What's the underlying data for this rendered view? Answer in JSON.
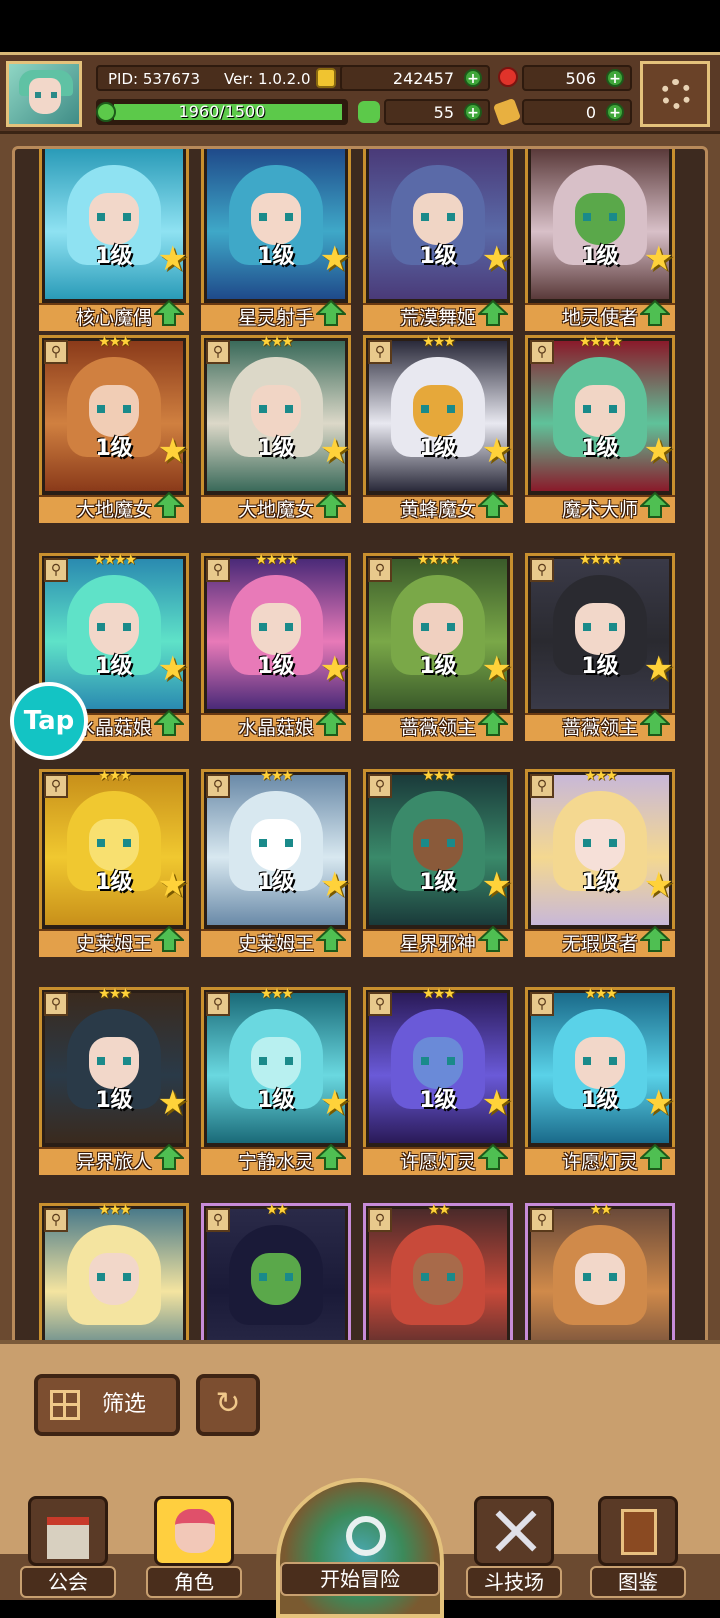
{
  "header": {
    "pid_label": "PID: 537673",
    "version_label": "Ver: 1.0.2.0",
    "gold": "242457",
    "gems": "506",
    "clover": "55",
    "tickets": "0",
    "xp_text": "1960/1500",
    "xp_fraction": 1.0
  },
  "colors": {
    "gold_coin": "#f0c430",
    "gem": "#e0332a",
    "clover": "#5cc94a",
    "accent": "#c9902e"
  },
  "characters": [
    {
      "name": "核心魔偶",
      "level": "1级",
      "palette": [
        "#2a9bb8",
        "#8fe2f2",
        "#f2d7c9"
      ]
    },
    {
      "name": "星灵射手",
      "level": "1级",
      "palette": [
        "#1f4a8a",
        "#3fa8c8",
        "#f3d7c8"
      ]
    },
    {
      "name": "荒漠舞姬",
      "level": "1级",
      "palette": [
        "#4a3a78",
        "#5a6aa8",
        "#f0d5c5"
      ]
    },
    {
      "name": "地灵使者",
      "level": "1级",
      "palette": [
        "#5a3a3a",
        "#d8c0c8",
        "#5aa84a"
      ]
    },
    {
      "name": "大地魔女",
      "level": "1级",
      "rarity": "★★★",
      "palette": [
        "#8a3a1a",
        "#d08040",
        "#f1cdb5"
      ]
    },
    {
      "name": "大地魔女",
      "level": "1级",
      "rarity": "★★★",
      "palette": [
        "#3a6a5a",
        "#dcd8c8",
        "#f1d5c5"
      ]
    },
    {
      "name": "黄蜂魔女",
      "level": "1级",
      "rarity": "★★★",
      "palette": [
        "#2a2a3a",
        "#e8e8f0",
        "#e6a83a"
      ]
    },
    {
      "name": "魔术大师",
      "level": "1级",
      "rarity": "★★★★",
      "palette": [
        "#8a1a2a",
        "#5fc29a",
        "#f1d5c5"
      ]
    },
    {
      "name": "水晶菇娘",
      "level": "1级",
      "rarity": "★★★★",
      "palette": [
        "#2a8ab0",
        "#5fe2c8",
        "#f2d7c9"
      ]
    },
    {
      "name": "水晶菇娘",
      "level": "1级",
      "rarity": "★★★★",
      "palette": [
        "#4a2a78",
        "#e87ab8",
        "#f2d7c9"
      ]
    },
    {
      "name": "蔷薇领主",
      "level": "1级",
      "rarity": "★★★★",
      "palette": [
        "#3a5a2a",
        "#7aa848",
        "#f0d0c0"
      ]
    },
    {
      "name": "蔷薇领主",
      "level": "1级",
      "rarity": "★★★★",
      "palette": [
        "#3a3a48",
        "#2a2a30",
        "#f2d7c9"
      ]
    },
    {
      "name": "史莱姆王",
      "level": "1级",
      "rarity": "★★★",
      "palette": [
        "#c8901a",
        "#f0c830",
        "#f8e070"
      ]
    },
    {
      "name": "史莱姆王",
      "level": "1级",
      "rarity": "★★★",
      "palette": [
        "#6a8aa8",
        "#d8e8f0",
        "#ffffff"
      ]
    },
    {
      "name": "星界邪神",
      "level": "1级",
      "rarity": "★★★",
      "palette": [
        "#1a3a3a",
        "#3a8a6a",
        "#8a5a3a"
      ]
    },
    {
      "name": "无瑕贤者",
      "level": "1级",
      "rarity": "★★★",
      "palette": [
        "#c8b8d8",
        "#f4d890",
        "#f6e0d8"
      ]
    },
    {
      "name": "异界旅人",
      "level": "1级",
      "rarity": "★★★",
      "palette": [
        "#3a2a1e",
        "#2a3a48",
        "#f2d7c9"
      ]
    },
    {
      "name": "宁静水灵",
      "level": "1级",
      "rarity": "★★★",
      "palette": [
        "#1a6a78",
        "#6ad8e0",
        "#b8f0f0"
      ]
    },
    {
      "name": "许愿灯灵",
      "level": "1级",
      "rarity": "★★★",
      "palette": [
        "#2a1a58",
        "#6a5ad8",
        "#6a8ad8"
      ]
    },
    {
      "name": "许愿灯灵",
      "level": "1级",
      "rarity": "★★★",
      "palette": [
        "#1a6a8a",
        "#5ad2e8",
        "#f2d7c9"
      ]
    },
    {
      "name": "",
      "level": "",
      "rarity": "★★★",
      "palette": [
        "#4a7a8a",
        "#f4e4a0",
        "#f2d7c9"
      ]
    },
    {
      "name": "",
      "level": "",
      "rarity": "★★",
      "palette": [
        "#2a2a48",
        "#1a1a38",
        "#5aa84a"
      ]
    },
    {
      "name": "",
      "level": "",
      "rarity": "★★",
      "palette": [
        "#4a2a2a",
        "#c84a3a",
        "#a86a4a"
      ]
    },
    {
      "name": "",
      "level": "",
      "rarity": "★★",
      "palette": [
        "#6a4a3a",
        "#d08a4a",
        "#f2d7c9"
      ]
    }
  ],
  "filter_label": "筛选",
  "tap_badge": "Tap",
  "nav": {
    "guild": "公会",
    "characters": "角色",
    "adventure": "开始冒险",
    "arena": "斗技场",
    "codex": "图鉴"
  }
}
